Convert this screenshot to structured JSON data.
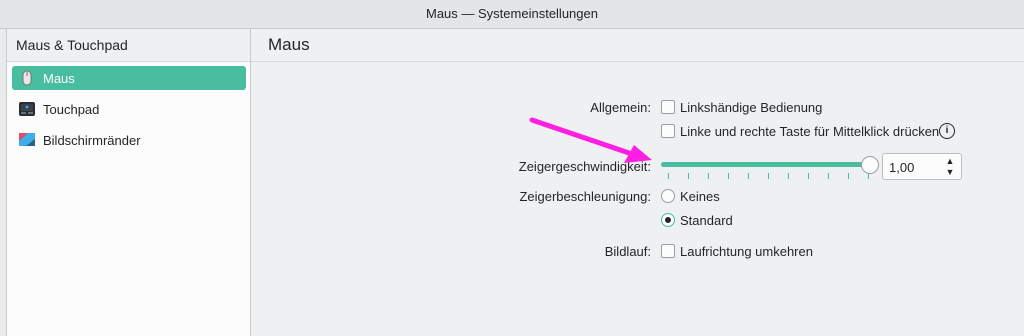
{
  "window": {
    "title": "Maus — Systemeinstellungen"
  },
  "sidebar": {
    "header": "Maus & Touchpad",
    "items": [
      {
        "label": "Maus",
        "icon": "mouse-icon",
        "active": true
      },
      {
        "label": "Touchpad",
        "icon": "touchpad-icon",
        "active": false
      },
      {
        "label": "Bildschirmränder",
        "icon": "screen-edges-icon",
        "active": false
      }
    ]
  },
  "main": {
    "title": "Maus",
    "general": {
      "label": "Allgemein:",
      "left_handed": "Linkshändige Bedienung",
      "middle_click": "Linke und rechte Taste für Mittelklick drücken"
    },
    "pointer_speed": {
      "label": "Zeigergeschwindigkeit:",
      "value": "1,00",
      "fraction": 1.0
    },
    "acceleration": {
      "label": "Zeigerbeschleunigung:",
      "options": [
        {
          "label": "Keines",
          "checked": false
        },
        {
          "label": "Standard",
          "checked": true
        }
      ]
    },
    "scrolling": {
      "label": "Bildlauf:",
      "reverse": "Laufrichtung umkehren"
    }
  },
  "colors": {
    "accent": "#48bd9f",
    "annotation_arrow": "#ff1fe3"
  }
}
